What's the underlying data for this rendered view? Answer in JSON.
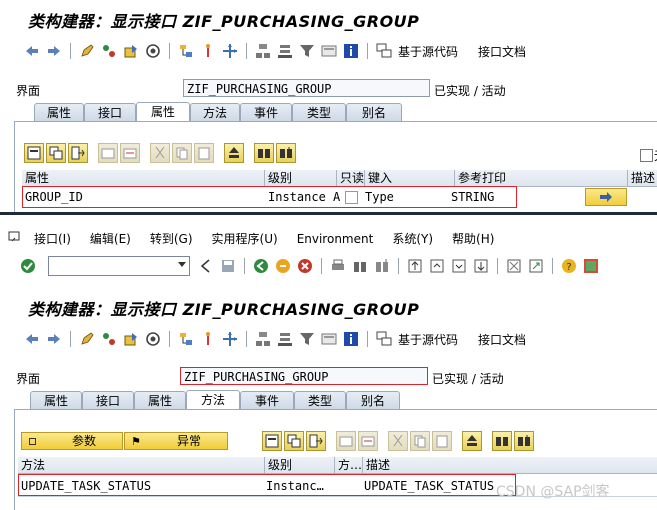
{
  "top": {
    "title": "类构建器：显示接口 ZIF_PURCHASING_GROUP",
    "toolbar_text": {
      "based_on_source": "基于源代码",
      "interface_doc": "接口文档"
    },
    "interface_label": "界面",
    "interface_value": "ZIF_PURCHASING_GROUP",
    "status": "已实现 / 活动",
    "tabs": [
      "属性",
      "接口",
      "属性",
      "方法",
      "事件",
      "类型",
      "别名"
    ],
    "active_tab": 2,
    "columns": [
      "属性",
      "级别",
      "只读",
      "键入",
      "参考打印",
      "描述"
    ],
    "rows": [
      {
        "name": "GROUP_ID",
        "level": "Instance A…",
        "typing": "Type",
        "ref": "STRING"
      }
    ],
    "checkbox_label": "无"
  },
  "bottom": {
    "menu": [
      "接口(I)",
      "编辑(E)",
      "转到(G)",
      "实用程序(U)",
      "Environment",
      "系统(Y)",
      "帮助(H)"
    ],
    "command_field": "",
    "title": "类构建器：显示接口 ZIF_PURCHASING_GROUP",
    "toolbar_text": {
      "based_on_source": "基于源代码",
      "interface_doc": "接口文档"
    },
    "interface_label": "界面",
    "interface_value": "ZIF_PURCHASING_GROUP",
    "status": "已实现 / 活动",
    "tabs": [
      "属性",
      "接口",
      "属性",
      "方法",
      "事件",
      "类型",
      "别名"
    ],
    "active_tab": 3,
    "param_button": "参数",
    "exception_button": "异常",
    "columns": [
      "方法",
      "级别",
      "方…",
      "描述"
    ],
    "rows": [
      {
        "name": "UPDATE_TASK_STATUS",
        "level": "Instanc…",
        "desc": "UPDATE_TASK_STATUS"
      }
    ]
  },
  "watermark": "CSDN @SAP剑客",
  "colors": {
    "highlight_border": "#d8242a",
    "tab_bg": "#dbe3ee",
    "button_yellow": "#f0cd3a",
    "panel_bg": "#ffffff"
  }
}
